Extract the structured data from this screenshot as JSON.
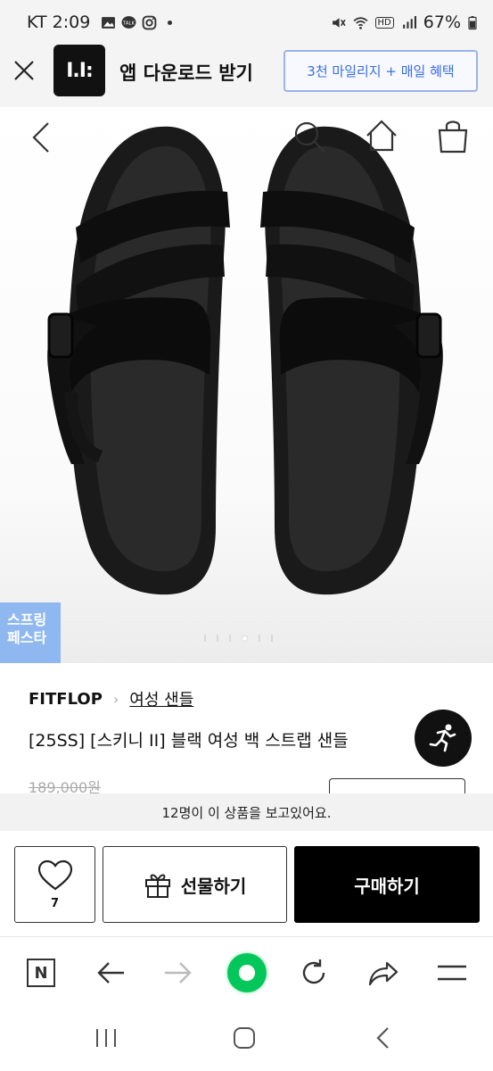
{
  "status_bar": {
    "carrier_time": "KT 2:09",
    "battery": "67%",
    "hd_label": "HD",
    "talk_label": "TALK"
  },
  "app_banner": {
    "logo_text": "I.I:",
    "title": "앱 다운로드 받기",
    "promo_button": "3천 마일리지 + 매일 혜택"
  },
  "product_gallery": {
    "badge_line1": "스프링",
    "badge_line2": "페스타",
    "dot_count": 5,
    "active_dot": 3
  },
  "product": {
    "brand": "FITFLOP",
    "breadcrumb_separator": "›",
    "category": "여성 샌들",
    "title": "[25SS] [스키니 II] 블랙 여성 백 스트랩 샌들",
    "original_price": "189,000원"
  },
  "viewers_notice": "12명이 이 상품을 보고있어요.",
  "actions": {
    "like_count": "7",
    "gift_label": "선물하기",
    "buy_label": "구매하기"
  },
  "browser_toolbar": {
    "items": [
      "naver-home",
      "back",
      "forward",
      "green-dot",
      "refresh",
      "share",
      "menu"
    ],
    "naver_label": "N"
  },
  "colors": {
    "accent_blue": "#3a6ee0",
    "badge_blue": "#8fb7f0",
    "buy_black": "#000000",
    "naver_green": "#03c75a"
  }
}
